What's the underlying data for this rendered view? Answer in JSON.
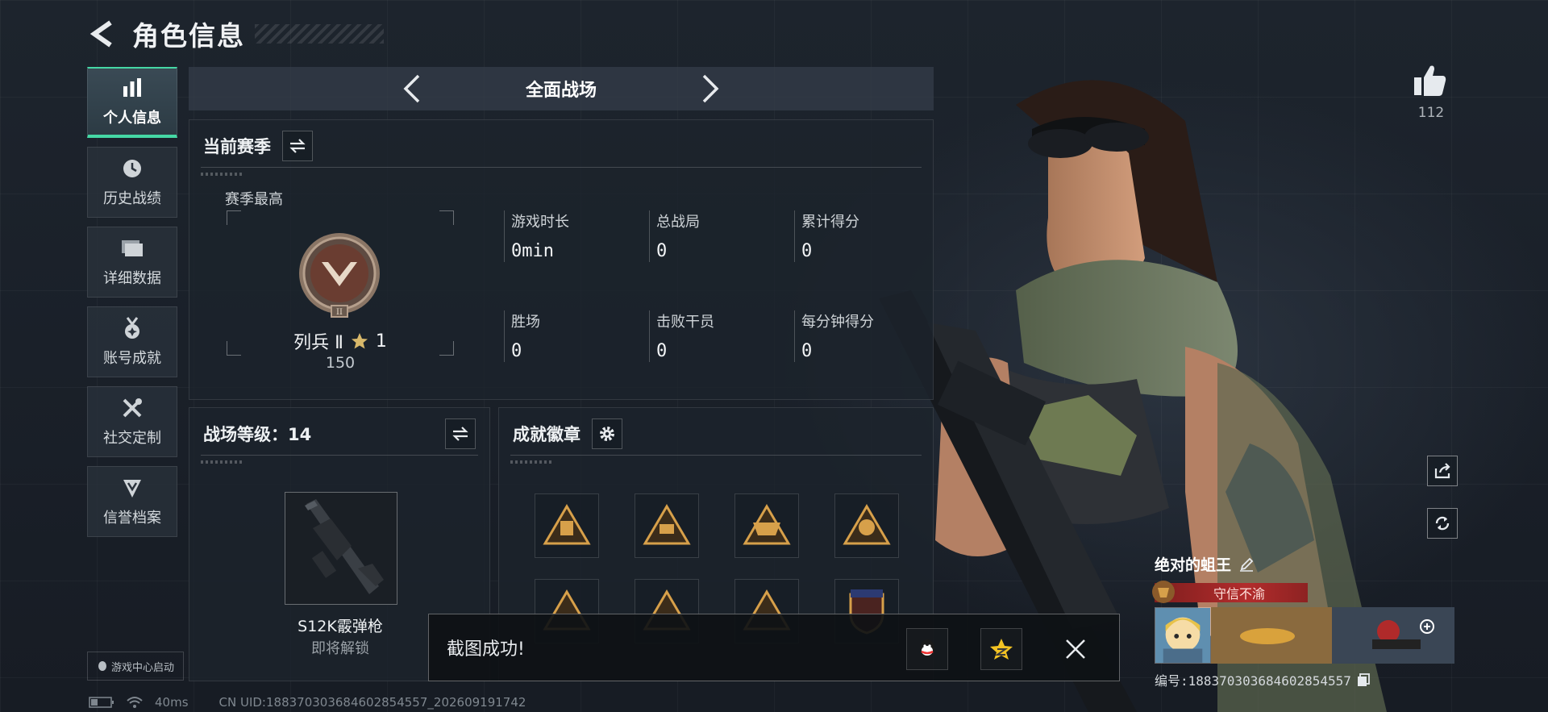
{
  "header": {
    "title": "角色信息"
  },
  "nav": {
    "items": [
      {
        "label": "个人信息",
        "icon": "bar-chart-icon",
        "active": true
      },
      {
        "label": "历史战绩",
        "icon": "clock-icon",
        "active": false
      },
      {
        "label": "详细数据",
        "icon": "folder-icon",
        "active": false
      },
      {
        "label": "账号成就",
        "icon": "medal-icon",
        "active": false
      },
      {
        "label": "社交定制",
        "icon": "tools-icon",
        "active": false
      },
      {
        "label": "信誉档案",
        "icon": "shield-icon",
        "active": false
      }
    ],
    "game_center": "游戏中心启动"
  },
  "mode": {
    "name": "全面战场"
  },
  "season": {
    "title": "当前赛季",
    "best_label": "赛季最高",
    "rank_name": "列兵 Ⅱ",
    "rank_stars": "1",
    "rank_points": "150",
    "stats": [
      {
        "label": "游戏时长",
        "value": "0min"
      },
      {
        "label": "总战局",
        "value": "0"
      },
      {
        "label": "累计得分",
        "value": "0"
      },
      {
        "label": "胜场",
        "value": "0"
      },
      {
        "label": "击败干员",
        "value": "0"
      },
      {
        "label": "每分钟得分",
        "value": "0"
      }
    ]
  },
  "level": {
    "title": "战场等级：14",
    "weapon_name": "S12K霰弹枪",
    "weapon_status": "即将解锁"
  },
  "badges": {
    "title": "成就徽章",
    "items": [
      "badge-1",
      "badge-2",
      "badge-3",
      "badge-4",
      "badge-5",
      "badge-6",
      "badge-7",
      "badge-8"
    ]
  },
  "toast": {
    "text": "截图成功!"
  },
  "profile": {
    "likes": "112",
    "name": "绝对的蛆王",
    "title_tag": "守信不渝",
    "uid": "编号:18837030368460285455​7"
  },
  "status": {
    "ping": "40ms",
    "cn_uid": "CN UID:18837030368460285455​7_202609191742"
  },
  "colors": {
    "accent": "#45d8a5",
    "badge_gold": "#d7a04a",
    "title_red": "#b22c2c"
  }
}
